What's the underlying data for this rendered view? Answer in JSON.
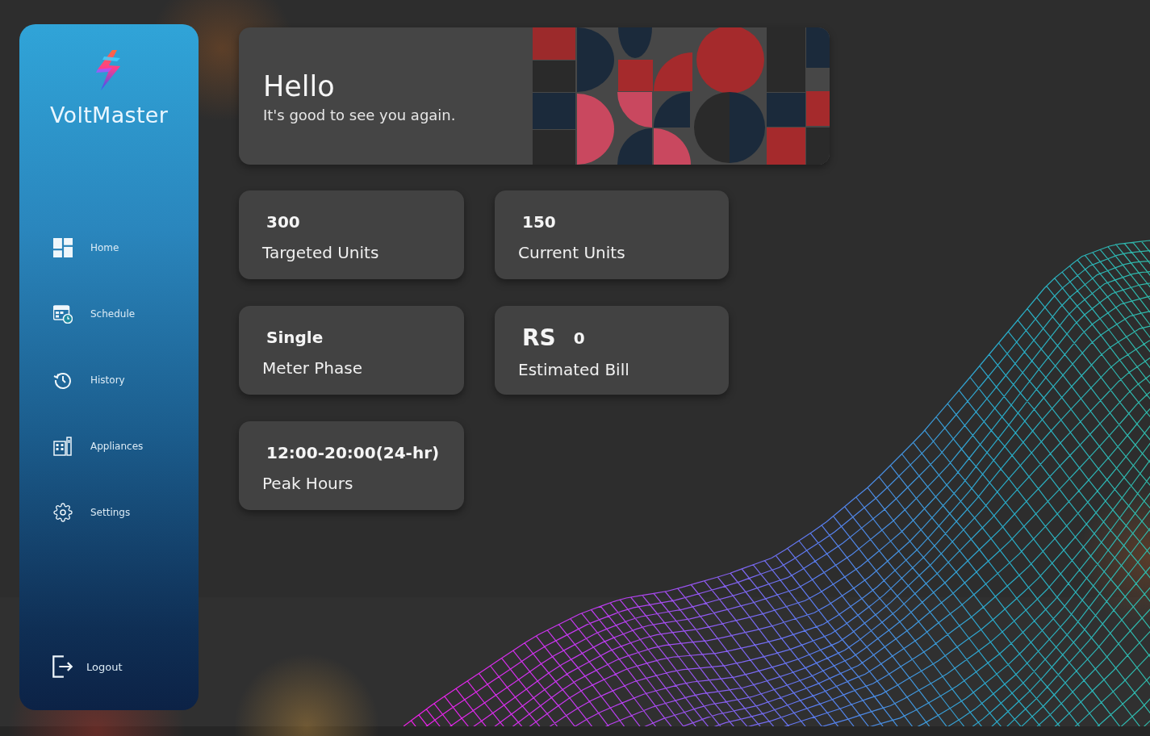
{
  "sidebar": {
    "brand": "VoltMaster",
    "nav": [
      {
        "label": "Home"
      },
      {
        "label": "Schedule"
      },
      {
        "label": "History"
      },
      {
        "label": "Appliances"
      },
      {
        "label": "Settings"
      }
    ],
    "logout": {
      "label": "Logout"
    }
  },
  "greeting": {
    "title": "Hello",
    "subtitle": "It's good to see you again."
  },
  "stats": [
    {
      "value": "300",
      "label": "Targeted Units"
    },
    {
      "value": "150",
      "label": "Current Units"
    },
    {
      "value": "Single",
      "label": "Meter Phase"
    },
    {
      "currency": "RS",
      "value": "0",
      "label": "Estimated Bill"
    },
    {
      "value": "12:00-20:00(24-hr)",
      "label": "Peak Hours"
    }
  ]
}
